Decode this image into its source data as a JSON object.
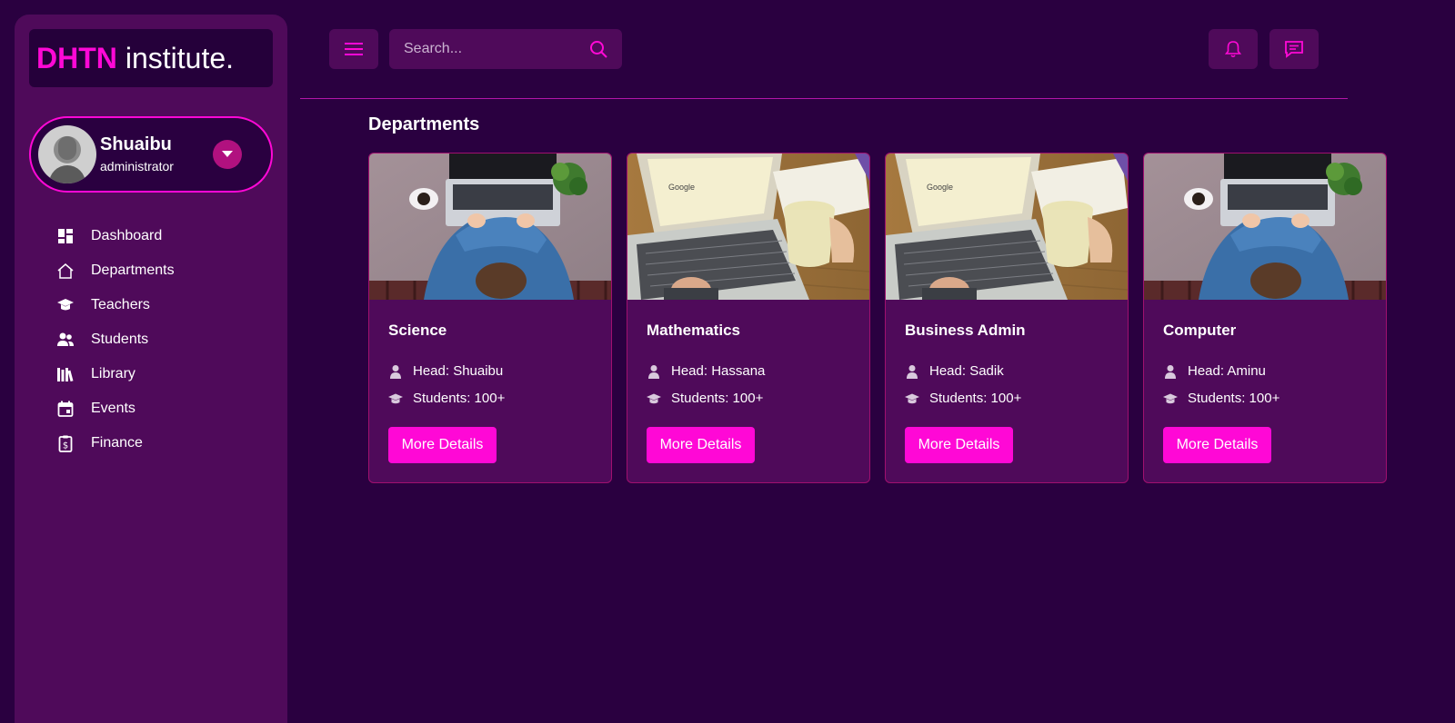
{
  "brand": {
    "part1": "DHTN",
    "part2": "institute."
  },
  "profile": {
    "name": "Shuaibu",
    "role": "administrator"
  },
  "nav": [
    {
      "label": "Dashboard",
      "icon": "dashboard-icon"
    },
    {
      "label": "Departments",
      "icon": "house-icon"
    },
    {
      "label": "Teachers",
      "icon": "graduation-cap-icon"
    },
    {
      "label": "Students",
      "icon": "users-icon"
    },
    {
      "label": "Library",
      "icon": "books-icon"
    },
    {
      "label": "Events",
      "icon": "calendar-icon"
    },
    {
      "label": "Finance",
      "icon": "clipboard-dollar-icon"
    }
  ],
  "search": {
    "placeholder": "Search..."
  },
  "section_title": "Departments",
  "departments": [
    {
      "name": "Science",
      "head": "Head: Shuaibu",
      "students": "Students: 100+",
      "button": "More Details",
      "image": "laptop-top-view"
    },
    {
      "name": "Mathematics",
      "head": "Head: Hassana",
      "students": "Students: 100+",
      "button": "More Details",
      "image": "laptop-coffee"
    },
    {
      "name": "Business Admin",
      "head": "Head: Sadik",
      "students": "Students: 100+",
      "button": "More Details",
      "image": "laptop-coffee"
    },
    {
      "name": "Computer",
      "head": "Head: Aminu",
      "students": "Students: 100+",
      "button": "More Details",
      "image": "laptop-top-view"
    }
  ],
  "colors": {
    "accent": "#ff08d6",
    "background": "#2a0040",
    "panel": "#4f0a5a"
  }
}
